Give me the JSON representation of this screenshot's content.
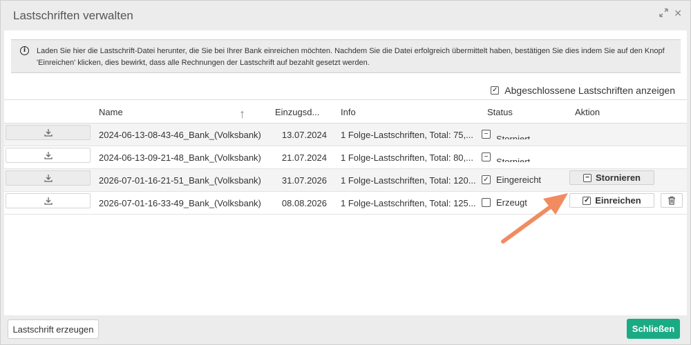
{
  "window": {
    "title": "Lastschriften verwalten"
  },
  "info": {
    "text": "Laden Sie hier die Lastschrift-Datei herunter, die Sie bei Ihrer Bank einreichen möchten. Nachdem Sie die Datei erfolgreich übermittelt haben, bestätigen Sie dies indem Sie auf den Knopf 'Einreichen' klicken, dies bewirkt, dass alle Rechnungen der Lastschrift auf bezahlt gesetzt werden."
  },
  "filter": {
    "show_closed_label": "Abgeschlossene Lastschriften anzeigen",
    "show_closed_checked": true
  },
  "table": {
    "columns": {
      "name": "Name",
      "date": "Einzugsd...",
      "info": "Info",
      "status": "Status",
      "action": "Aktion"
    },
    "rows": [
      {
        "name": "2024-06-13-08-43-46_Bank_(Volksbank)",
        "date": "13.07.2024",
        "info": "1 Folge-Lastschriften, Total: 75,...",
        "status": "Storniert",
        "status_icon": "minus-box"
      },
      {
        "name": "2024-06-13-09-21-48_Bank_(Volksbank)",
        "date": "21.07.2024",
        "info": "1 Folge-Lastschriften, Total: 80,...",
        "status": "Storniert",
        "status_icon": "minus-box"
      },
      {
        "name": "2026-07-01-16-21-51_Bank_(Volksbank)",
        "date": "31.07.2026",
        "info": "1 Folge-Lastschriften, Total: 120...",
        "status": "Eingereicht",
        "status_icon": "check-box",
        "action_label": "Stornieren"
      },
      {
        "name": "2026-07-01-16-33-49_Bank_(Volksbank)",
        "date": "08.08.2026",
        "info": "1 Folge-Lastschriften, Total: 125...",
        "status": "Erzeugt",
        "status_icon": "empty-box",
        "action_label": "Einreichen"
      }
    ]
  },
  "footer": {
    "create_label": "Lastschrift erzeugen",
    "close_label": "Schließen"
  },
  "colors": {
    "primary": "#1aab84",
    "annotation_arrow": "#f08c60"
  }
}
